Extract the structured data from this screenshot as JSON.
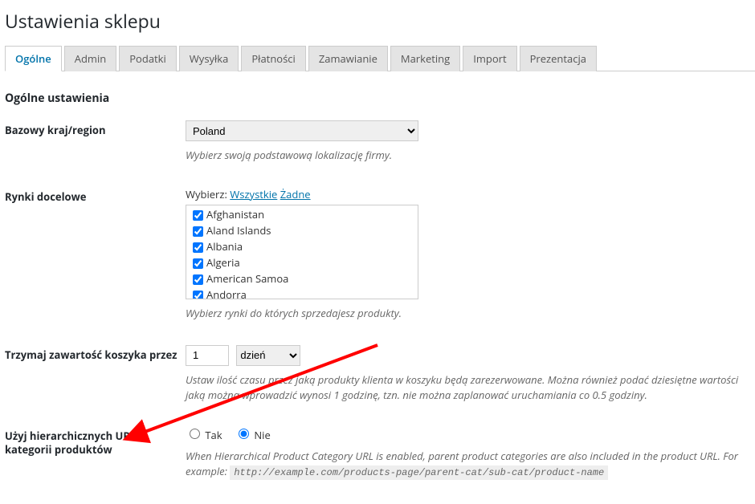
{
  "page_title": "Ustawienia sklepu",
  "tabs": [
    "Ogólne",
    "Admin",
    "Podatki",
    "Wysyłka",
    "Płatności",
    "Zamawianie",
    "Marketing",
    "Import",
    "Prezentacja"
  ],
  "section_heading": "Ogólne ustawienia",
  "base_location": {
    "label": "Bazowy kraj/region",
    "selected": "Poland",
    "description": "Wybierz swoją podstawową lokalizację firmy."
  },
  "target_markets": {
    "label": "Rynki docelowe",
    "select_prefix": "Wybierz:",
    "link_all": "Wszystkie",
    "link_none": "Żadne",
    "countries": [
      "Afghanistan",
      "Aland Islands",
      "Albania",
      "Algeria",
      "American Samoa",
      "Andorra"
    ],
    "description": "Wybierz rynki do których sprzedajesz produkty."
  },
  "cart_retention": {
    "label": "Trzymaj zawartość koszyka przez",
    "value": "1",
    "unit": "dzień",
    "description": "Ustaw ilość czasu przez jaką produkty klienta w koszyku będą zarezerwowane. Można również podać dziesiętne wartości jaką można wprowadzić wynosi 1 godzinę, tzn. nie można zaplanować uruchamiania co 0.5 godziny."
  },
  "hierarchical_url": {
    "label": "Użyj hierarchicznych URLi kategorii produktów",
    "yes": "Tak",
    "no": "Nie",
    "selected": "Nie",
    "desc_prefix": "When Hierarchical Product Category URL is enabled, parent product categories are also included in the product URL. For example:",
    "url_example": "http://example.com/products-page/parent-cat/sub-cat/product-name"
  }
}
